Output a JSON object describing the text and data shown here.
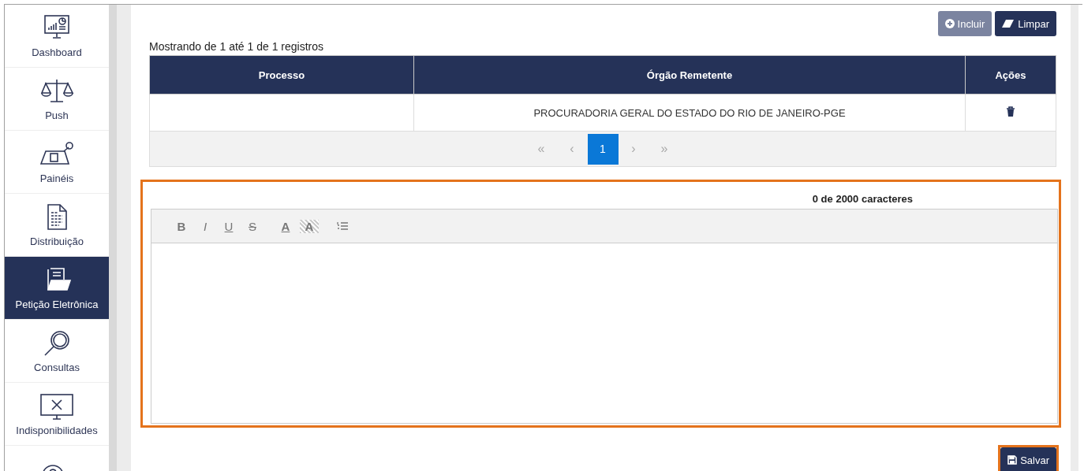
{
  "sidebar": {
    "items": [
      {
        "label": "Dashboard",
        "kind": "dashboard",
        "selected": false
      },
      {
        "label": "Push",
        "kind": "scales",
        "selected": false
      },
      {
        "label": "Painéis",
        "kind": "desk",
        "selected": false
      },
      {
        "label": "Distribuição",
        "kind": "document",
        "selected": false
      },
      {
        "label": "Petição Eletrônica",
        "kind": "folder",
        "selected": true
      },
      {
        "label": "Consultas",
        "kind": "search",
        "selected": false
      },
      {
        "label": "Indisponibilidades",
        "kind": "monitor",
        "selected": false
      },
      {
        "kind": "help",
        "selected": false
      }
    ]
  },
  "actions": [
    {
      "label": "Incluir",
      "kind": "add",
      "disabled": true
    },
    {
      "label": "Limpar",
      "kind": "clear",
      "disabled": false
    }
  ],
  "table": {
    "summary": "Mostrando de 1 até 1 de 1 registros",
    "columns": [
      "Processo",
      "Órgão Remetente",
      "Ações"
    ],
    "rows": [
      {
        "cells": [
          "",
          "PROCURADORIA GERAL DO ESTADO DO RIO DE JANEIRO-PGE"
        ],
        "delete": true
      }
    ],
    "pagination": [
      {
        "label": "«",
        "selected": false
      },
      {
        "label": "‹",
        "selected": false
      },
      {
        "label": "1",
        "selected": true
      },
      {
        "label": "›",
        "selected": false
      },
      {
        "label": "»",
        "selected": false
      }
    ]
  },
  "editor": {
    "highlighted": true,
    "counter": "0 de 2000 caracteres",
    "toolbar": [
      {
        "label": "B",
        "kind": "bold"
      },
      {
        "label": "I",
        "kind": "italic"
      },
      {
        "label": "U",
        "kind": "underline"
      },
      {
        "label": "S",
        "kind": "strike"
      },
      {
        "label": "A",
        "kind": "color"
      },
      {
        "label": "A",
        "kind": "highlight"
      },
      {
        "kind": "list"
      }
    ]
  },
  "save": {
    "label": "Salvar",
    "highlighted": true
  }
}
